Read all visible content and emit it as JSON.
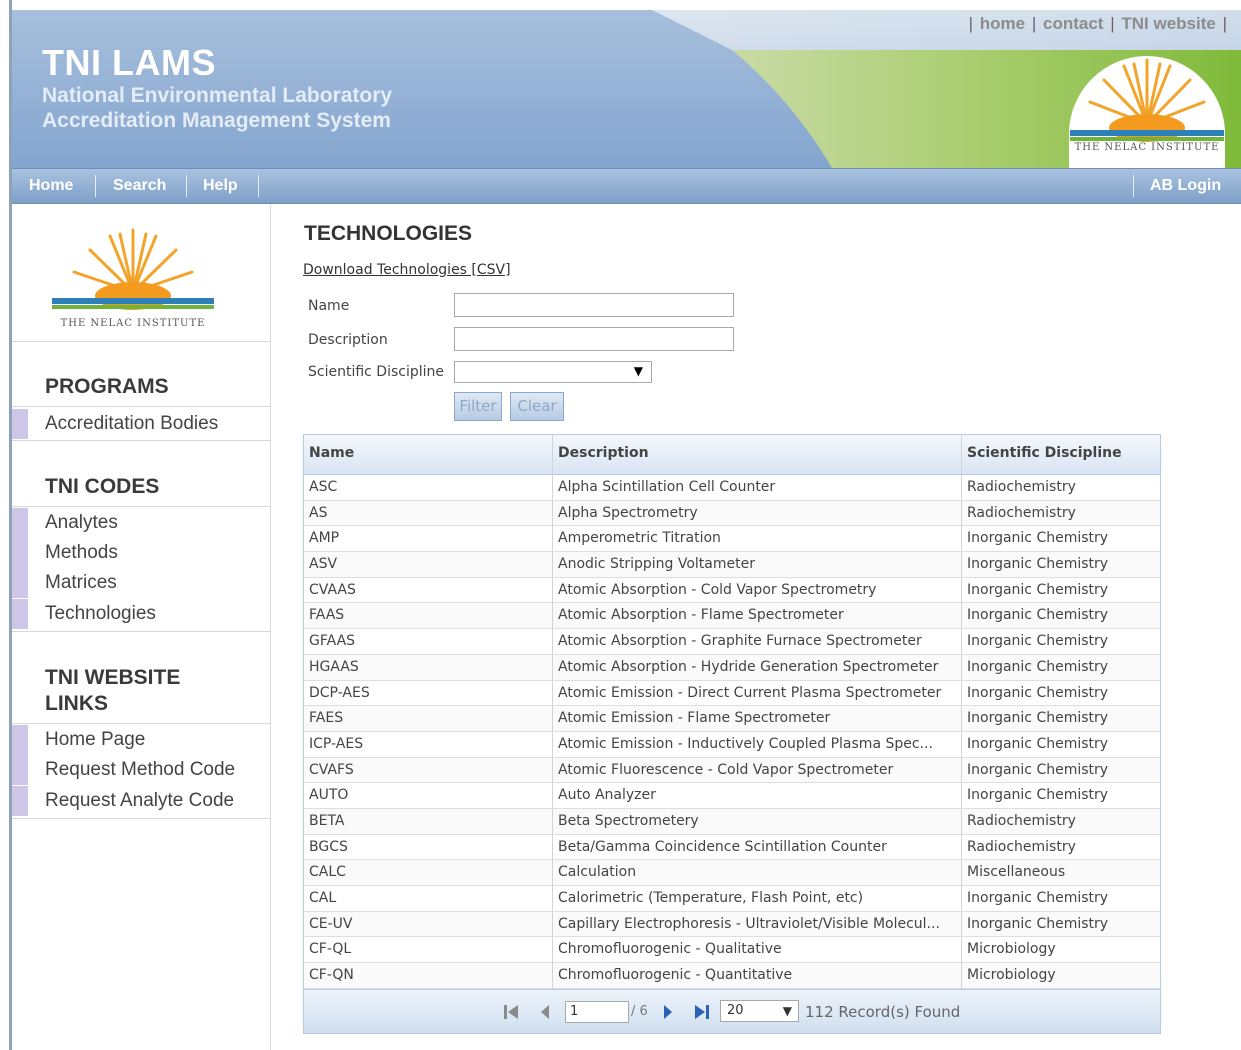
{
  "header": {
    "title": "TNI LAMS",
    "subtitle_line1": "National Environmental Laboratory",
    "subtitle_line2": "Accreditation Management System",
    "logo_text": "THE NELAC INSTITUTE",
    "top_links": [
      "home",
      "contact",
      "TNI website"
    ]
  },
  "nav": {
    "items": [
      "Home",
      "Search",
      "Help"
    ],
    "login": "AB Login"
  },
  "sidebar": {
    "logo_text": "THE NELAC INSTITUTE",
    "sections": [
      {
        "heading": "PROGRAMS",
        "items": [
          "Accreditation Bodies"
        ]
      },
      {
        "heading": "TNI CODES",
        "items": [
          "Analytes",
          "Methods",
          "Matrices",
          "Technologies"
        ]
      },
      {
        "heading_line1": "TNI WEBSITE",
        "heading_line2": "LINKS",
        "items": [
          "Home Page",
          "Request Method Code",
          "Request Analyte Code"
        ]
      }
    ]
  },
  "main": {
    "title": "TECHNOLOGIES",
    "download_link": "Download Technologies [CSV]",
    "filters": {
      "name_label": "Name",
      "name_value": "",
      "description_label": "Description",
      "description_value": "",
      "discipline_label": "Scientific Discipline",
      "discipline_value": "",
      "filter_button": "Filter",
      "clear_button": "Clear"
    },
    "table": {
      "columns": [
        "Name",
        "Description",
        "Scientific Discipline"
      ],
      "rows": [
        [
          "ASC",
          "Alpha Scintillation Cell Counter",
          "Radiochemistry"
        ],
        [
          "AS",
          "Alpha Spectrometry",
          "Radiochemistry"
        ],
        [
          "AMP",
          "Amperometric Titration",
          "Inorganic Chemistry"
        ],
        [
          "ASV",
          "Anodic Stripping Voltameter",
          "Inorganic Chemistry"
        ],
        [
          "CVAAS",
          "Atomic Absorption - Cold Vapor Spectrometry",
          "Inorganic Chemistry"
        ],
        [
          "FAAS",
          "Atomic Absorption - Flame Spectrometer",
          "Inorganic Chemistry"
        ],
        [
          "GFAAS",
          "Atomic Absorption - Graphite Furnace Spectrometer",
          "Inorganic Chemistry"
        ],
        [
          "HGAAS",
          "Atomic Absorption - Hydride Generation Spectrometer",
          "Inorganic Chemistry"
        ],
        [
          "DCP-AES",
          "Atomic Emission - Direct Current Plasma Spectrometer",
          "Inorganic Chemistry"
        ],
        [
          "FAES",
          "Atomic Emission - Flame Spectrometer",
          "Inorganic Chemistry"
        ],
        [
          "ICP-AES",
          "Atomic Emission - Inductively Coupled Plasma Spec...",
          "Inorganic Chemistry"
        ],
        [
          "CVAFS",
          "Atomic Fluorescence - Cold Vapor Spectrometer",
          "Inorganic Chemistry"
        ],
        [
          "AUTO",
          "Auto Analyzer",
          "Inorganic Chemistry"
        ],
        [
          "BETA",
          "Beta Spectrometery",
          "Radiochemistry"
        ],
        [
          "BGCS",
          "Beta/Gamma Coincidence Scintillation Counter",
          "Radiochemistry"
        ],
        [
          "CALC",
          "Calculation",
          "Miscellaneous"
        ],
        [
          "CAL",
          "Calorimetric (Temperature, Flash Point, etc)",
          "Inorganic Chemistry"
        ],
        [
          "CE-UV",
          "Capillary Electrophoresis - Ultraviolet/Visible Molecul...",
          "Inorganic Chemistry"
        ],
        [
          "CF-QL",
          "Chromofluorogenic - Qualitative",
          "Microbiology"
        ],
        [
          "CF-QN",
          "Chromofluorogenic - Quantitative",
          "Microbiology"
        ]
      ]
    },
    "pager": {
      "current_page": "1",
      "page_of": "/ 6",
      "page_size": "20",
      "record_count": "112 Record(s) Found"
    }
  }
}
